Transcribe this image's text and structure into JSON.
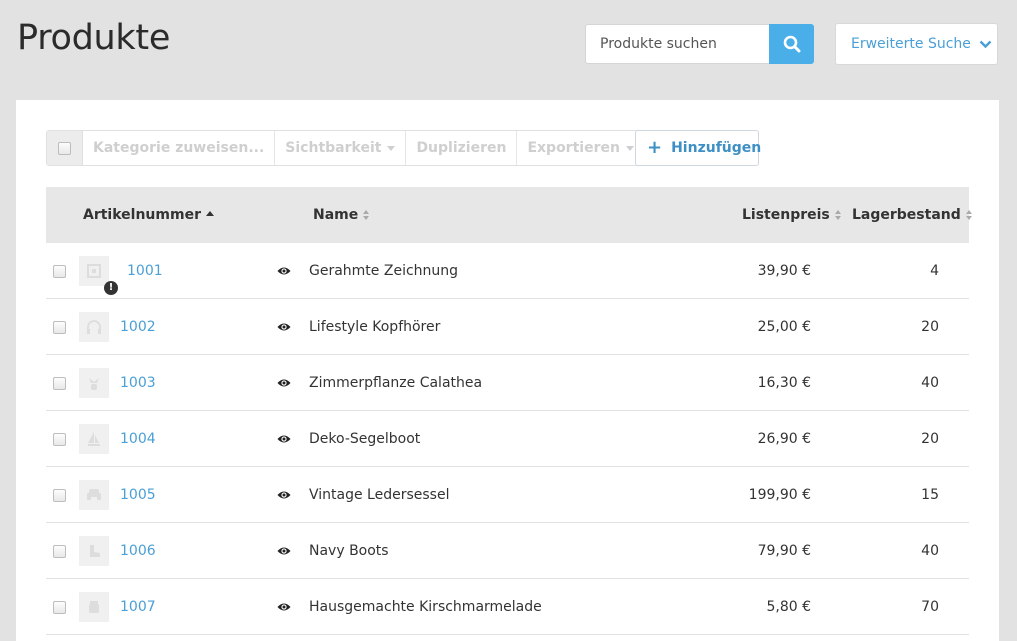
{
  "page": {
    "title": "Produkte"
  },
  "search": {
    "placeholder": "Produkte suchen",
    "advanced_label": "Erweiterte Suche"
  },
  "toolbar": {
    "assign_category": "Kategorie zuweisen...",
    "visibility": "Sichtbarkeit",
    "duplicate": "Duplizieren",
    "export": "Exportieren",
    "add": "Hinzufügen"
  },
  "table": {
    "headers": {
      "sku": "Artikelnummer",
      "name": "Name",
      "price": "Listenpreis",
      "stock": "Lagerbestand"
    },
    "rows": [
      {
        "sku": "1001",
        "name": "Gerahmte Zeichnung",
        "price": "39,90 €",
        "stock": "4",
        "icon": "framed-picture-icon",
        "warning": true
      },
      {
        "sku": "1002",
        "name": "Lifestyle Kopfhörer",
        "price": "25,00 €",
        "stock": "20",
        "icon": "headphones-icon",
        "warning": false
      },
      {
        "sku": "1003",
        "name": "Zimmerpflanze Calathea",
        "price": "16,30 €",
        "stock": "40",
        "icon": "plant-icon",
        "warning": false
      },
      {
        "sku": "1004",
        "name": "Deko-Segelboot",
        "price": "26,90 €",
        "stock": "20",
        "icon": "sailboat-icon",
        "warning": false
      },
      {
        "sku": "1005",
        "name": "Vintage Ledersessel",
        "price": "199,90 €",
        "stock": "15",
        "icon": "armchair-icon",
        "warning": false
      },
      {
        "sku": "1006",
        "name": "Navy Boots",
        "price": "79,90 €",
        "stock": "40",
        "icon": "boot-icon",
        "warning": false
      },
      {
        "sku": "1007",
        "name": "Hausgemachte Kirschmarmelade",
        "price": "5,80 €",
        "stock": "70",
        "icon": "jam-jar-icon",
        "warning": false
      }
    ]
  },
  "colors": {
    "accent": "#4aaee8",
    "link": "#4a9fd6",
    "background": "#e2e2e2"
  }
}
